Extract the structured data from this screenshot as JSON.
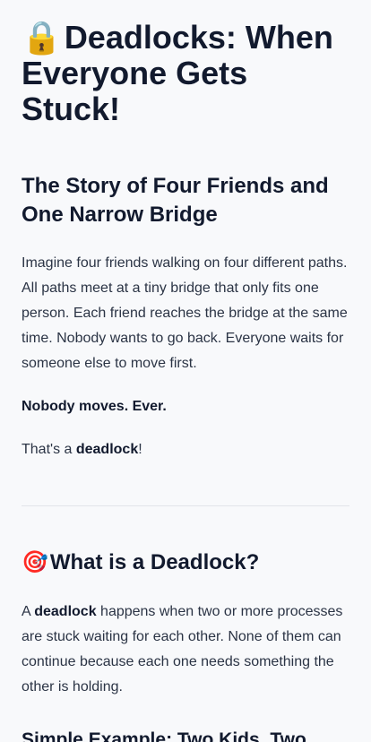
{
  "header": {
    "icon": "lock-icon",
    "icon_glyph": "🔒",
    "title": "Deadlocks: When Everyone Gets Stuck!"
  },
  "intro": {
    "title": "The Story of Four Friends and One Narrow Bridge",
    "story": "Imagine four friends walking on four different paths. All paths meet at a tiny bridge that only fits one person. Each friend reaches the bridge at the same time. Nobody wants to go back. Everyone waits for someone else to move first.",
    "no_move": "Nobody moves. Ever.",
    "deadlock_prefix": "That's a ",
    "deadlock_word": "deadlock",
    "deadlock_suffix": "!"
  },
  "what": {
    "icon": "target-icon",
    "icon_glyph": "🎯",
    "title": "What is a Deadlock?",
    "text_prefix": "A ",
    "text_bold": "deadlock",
    "text_suffix": " happens when two or more processes are stuck waiting for each other. None of them can continue because each one needs something the other is holding."
  },
  "example": {
    "title": "Simple Example: Two Kids, Two Toys"
  }
}
